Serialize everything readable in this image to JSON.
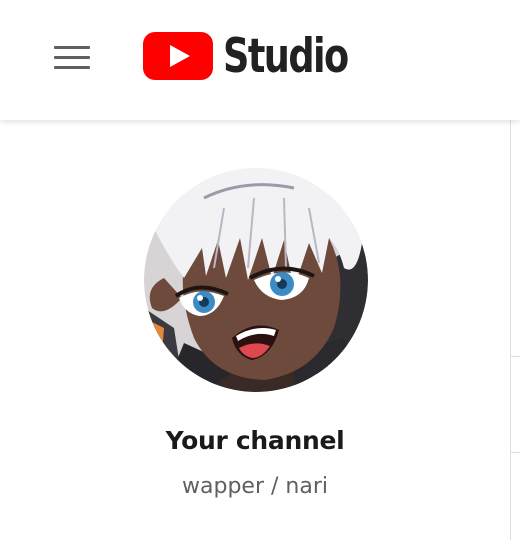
{
  "header": {
    "logo_text": "Studio",
    "logo_icon": "youtube-play-icon",
    "menu_icon": "hamburger-menu-icon"
  },
  "sidebar": {
    "avatar_icon": "channel-avatar",
    "channel_label": "Your channel",
    "channel_name": "wapper / nari"
  },
  "colors": {
    "brand_red": "#ff0000",
    "text_primary": "#1a1a1a",
    "text_secondary": "#606060",
    "icon_gray": "#606060"
  }
}
